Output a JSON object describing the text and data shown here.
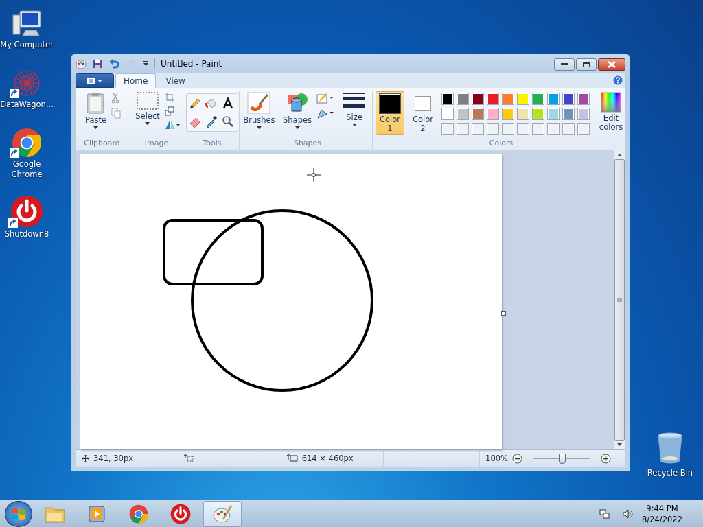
{
  "desktop_icons": [
    {
      "label": "My Computer",
      "kind": "computer",
      "shortcut": false
    },
    {
      "label": "DataWagon...",
      "kind": "web",
      "shortcut": true
    },
    {
      "label": "Google Chrome",
      "kind": "chrome",
      "shortcut": true
    },
    {
      "label": "Shutdown8",
      "kind": "power",
      "shortcut": true
    }
  ],
  "recycle_bin": {
    "label": "Recycle Bin"
  },
  "window": {
    "title": "Untitled - Paint"
  },
  "ribbon_tabs": [
    {
      "label": "Home",
      "selected": true
    },
    {
      "label": "View",
      "selected": false
    }
  ],
  "ribbon": {
    "clipboard": {
      "label": "Clipboard",
      "paste": "Paste"
    },
    "image": {
      "label": "Image",
      "select": "Select"
    },
    "tools": {
      "label": "Tools"
    },
    "brushes": "Brushes",
    "shapes": {
      "label": "Shapes",
      "button": "Shapes"
    },
    "size": "Size",
    "colors": {
      "label": "Colors",
      "edit": "Edit colors",
      "slots": [
        {
          "label": "Color 1",
          "color": "#000000",
          "selected": true
        },
        {
          "label": "Color 2",
          "color": "#ffffff",
          "selected": false
        }
      ],
      "palette": [
        {
          "color": "#000000"
        },
        {
          "color": "#7f7f7f"
        },
        {
          "color": "#880015"
        },
        {
          "color": "#ed1c24"
        },
        {
          "color": "#ff7f27"
        },
        {
          "color": "#fff200"
        },
        {
          "color": "#22b14c"
        },
        {
          "color": "#00a2e8"
        },
        {
          "color": "#3f48cc"
        },
        {
          "color": "#a349a4"
        },
        {
          "color": "#ffffff"
        },
        {
          "color": "#c3c3c3"
        },
        {
          "color": "#b97a57"
        },
        {
          "color": "#ffaec9"
        },
        {
          "color": "#ffc90e"
        },
        {
          "color": "#efe4b0"
        },
        {
          "color": "#b5e61d"
        },
        {
          "color": "#99d9ea"
        },
        {
          "color": "#7092be"
        },
        {
          "color": "#c8bfe7"
        }
      ]
    }
  },
  "status_bar": {
    "position": "341, 30px",
    "size": "614 × 460px",
    "zoom": "100%",
    "zoom_slider": {
      "level": 0.5
    }
  },
  "taskbar": {
    "items": [
      {
        "kind": "folder",
        "selected": false
      },
      {
        "kind": "media",
        "selected": false
      },
      {
        "kind": "chrome",
        "selected": false
      },
      {
        "kind": "power",
        "selected": false
      },
      {
        "kind": "paint",
        "selected": true
      }
    ],
    "time": "9:44 PM",
    "date": "8/24/2022"
  }
}
